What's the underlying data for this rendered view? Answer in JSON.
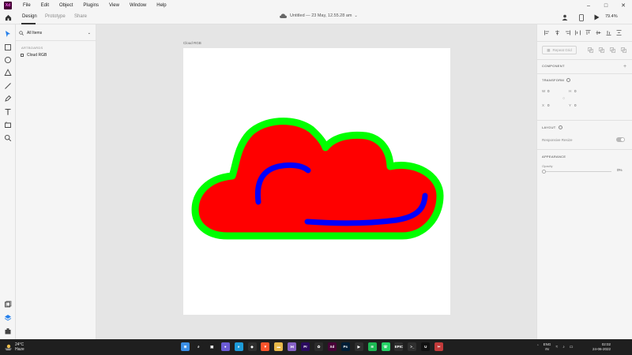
{
  "menubar": {
    "logo": "Xd",
    "items": [
      "File",
      "Edit",
      "Object",
      "Plugins",
      "View",
      "Window",
      "Help"
    ]
  },
  "tabs": {
    "design": "Design",
    "prototype": "Prototype",
    "share": "Share"
  },
  "document": {
    "title": "Untitled — 23 May, 12.55.28 am",
    "zoom": "79.4%"
  },
  "layers": {
    "filter_label": "All Items",
    "section_heading": "ARTBOARDS",
    "artboard_name": "Cloud RGB"
  },
  "canvas": {
    "artboard_label": "Cloud RGB",
    "colors": {
      "cloud_fill": "#ff0000",
      "cloud_outline": "#00ff00",
      "accent_strokes": "#0000ff",
      "artboard": "#ffffff"
    }
  },
  "inspector": {
    "repeat_grid": "Repeat Grid",
    "component_heading": "COMPONENT",
    "transform_heading": "TRANSFORM",
    "w_label": "W",
    "w_value": "0",
    "h_label": "H",
    "h_value": "0",
    "x_label": "X",
    "x_value": "0",
    "y_label": "Y",
    "y_value": "0",
    "layout_heading": "LAYOUT",
    "responsive_resize": "Responsive Resize",
    "appearance_heading": "APPEARANCE",
    "opacity_label": "Opacity",
    "opacity_value": "0%"
  },
  "taskbar": {
    "weather_temp": "24°C",
    "weather_desc": "Haze",
    "lang_top": "ENG",
    "lang_bottom": "IN",
    "time": "02:02",
    "date": "24-06-2022",
    "apps": [
      {
        "name": "start",
        "color": "#3a8ee6",
        "glyph": "⊞"
      },
      {
        "name": "search",
        "color": "#1f1f1f",
        "glyph": "⌕"
      },
      {
        "name": "task-view",
        "color": "#1f1f1f",
        "glyph": "▣"
      },
      {
        "name": "chat",
        "color": "#6b5bd6",
        "glyph": "●"
      },
      {
        "name": "edge",
        "color": "#1d9bd9",
        "glyph": "e"
      },
      {
        "name": "store",
        "color": "#2f2f2f",
        "glyph": "◆"
      },
      {
        "name": "brave",
        "color": "#fb542b",
        "glyph": "▼"
      },
      {
        "name": "explorer",
        "color": "#e8b94a",
        "glyph": "▬"
      },
      {
        "name": "visual-studio",
        "color": "#8661c5",
        "glyph": "⋈"
      },
      {
        "name": "premiere",
        "color": "#2a0a5e",
        "glyph": "Pr"
      },
      {
        "name": "figma",
        "color": "#2c2c2c",
        "glyph": "✿"
      },
      {
        "name": "xd",
        "color": "#470137",
        "glyph": "Xd"
      },
      {
        "name": "photoshop",
        "color": "#001e36",
        "glyph": "Ps"
      },
      {
        "name": "media",
        "color": "#2f2f2f",
        "glyph": "▶"
      },
      {
        "name": "spotify",
        "color": "#1db954",
        "glyph": "≋"
      },
      {
        "name": "whatsapp",
        "color": "#25d366",
        "glyph": "☏"
      },
      {
        "name": "epic",
        "color": "#2f2f2f",
        "glyph": "EPIC"
      },
      {
        "name": "terminal",
        "color": "#2f2f2f",
        "glyph": ">_"
      },
      {
        "name": "unreal",
        "color": "#111111",
        "glyph": "U"
      },
      {
        "name": "snipping",
        "color": "#c23a3a",
        "glyph": "✂"
      }
    ]
  }
}
